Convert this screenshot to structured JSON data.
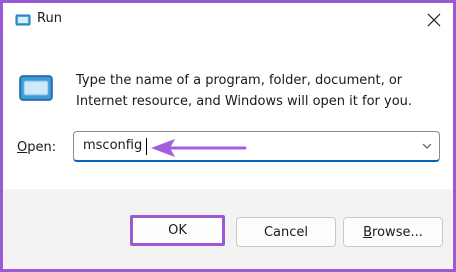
{
  "window": {
    "title": "Run",
    "close_icon": "close-icon",
    "app_icon": "run-app-icon"
  },
  "prompt": {
    "description": "Type the name of a program, folder, document, or Internet resource, and Windows will open it for you."
  },
  "open": {
    "label_access_key": "O",
    "label_rest": "pen:",
    "value": "msconfig"
  },
  "buttons": {
    "ok": "OK",
    "cancel": "Cancel",
    "browse_access_key": "B",
    "browse_rest": "rowse..."
  },
  "colors": {
    "highlight": "#9b59d6",
    "accent": "#0067c0"
  }
}
